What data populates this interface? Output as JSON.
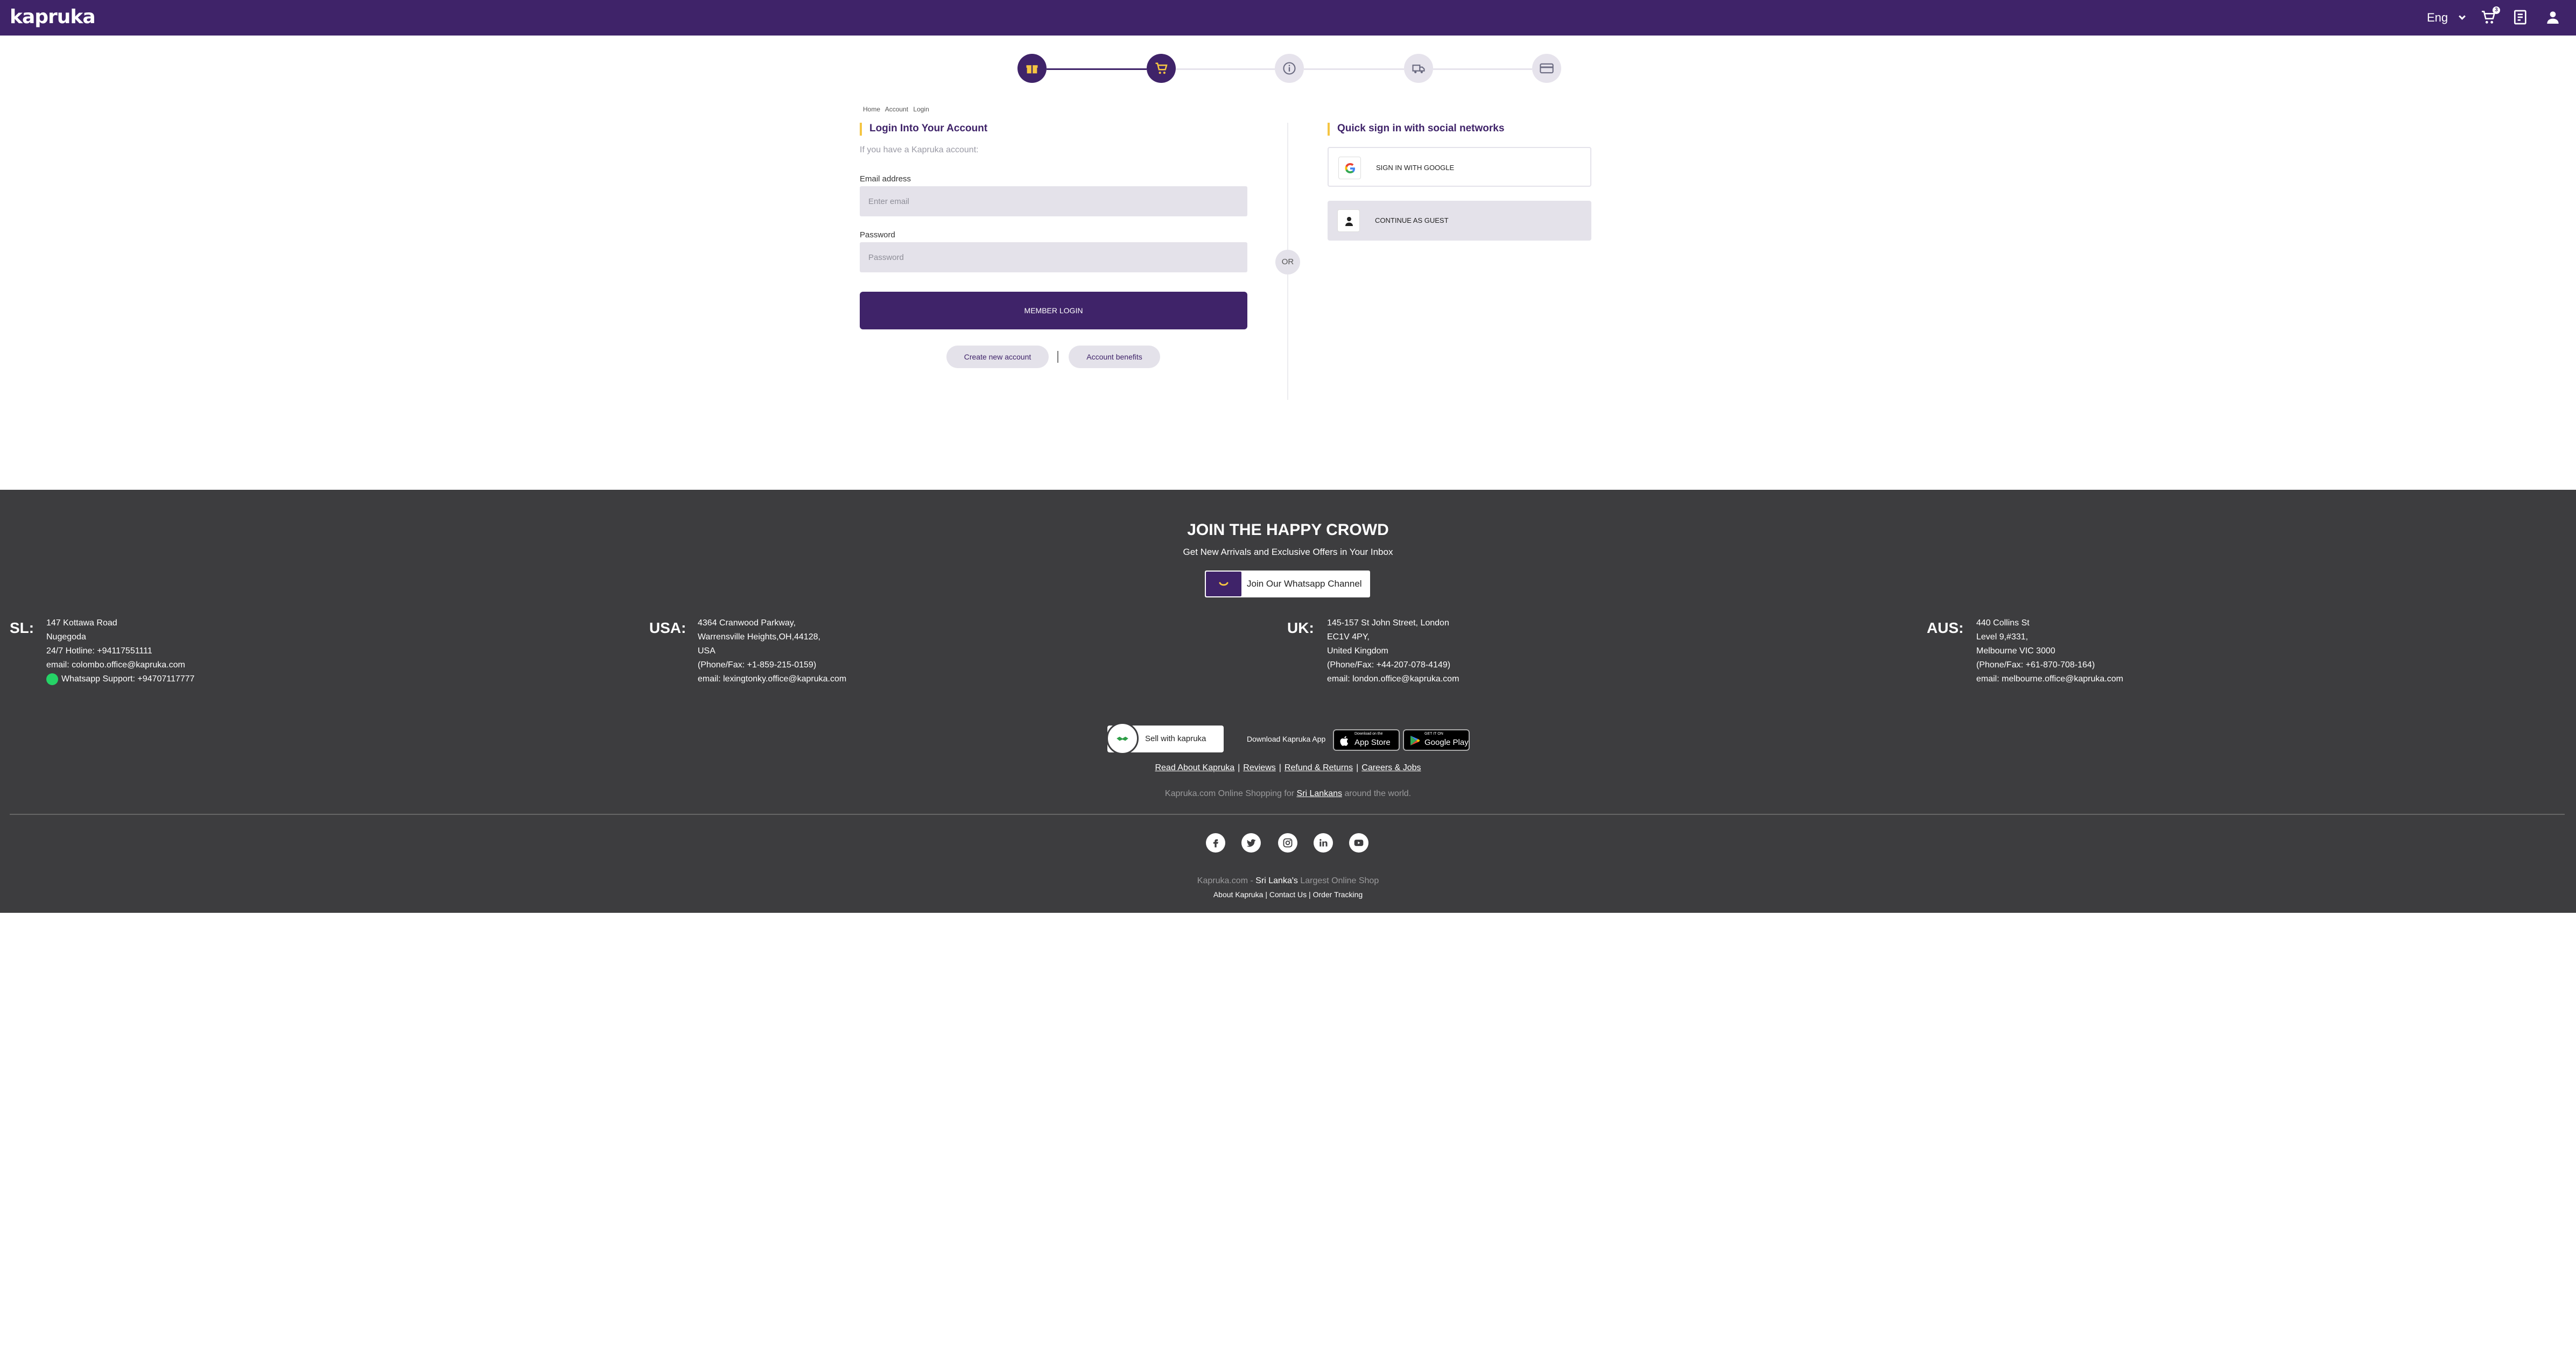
{
  "header": {
    "logo": "kapruka",
    "language": "Eng",
    "cart_count": "3",
    "icons": [
      "cart-icon",
      "orders-icon",
      "user-icon"
    ]
  },
  "checkout_steps": [
    {
      "icon": "gift-icon",
      "state": "done"
    },
    {
      "icon": "cart-icon",
      "state": "active"
    },
    {
      "icon": "info-icon",
      "state": "pending"
    },
    {
      "icon": "delivery-truck-icon",
      "state": "pending"
    },
    {
      "icon": "payment-card-icon",
      "state": "pending"
    }
  ],
  "breadcrumb": [
    "Home",
    "Account",
    "Login"
  ],
  "login": {
    "title": "Login Into Your Account",
    "subtitle": "If you have a Kapruka account:",
    "email_label": "Email address",
    "email_placeholder": "Enter email",
    "password_label": "Password",
    "password_placeholder": "Password",
    "submit_label": "MEMBER LOGIN",
    "create_account": "Create new account",
    "account_benefits": "Account benefits"
  },
  "or_label": "OR",
  "social": {
    "title": "Quick sign in with social networks",
    "google_label": "SIGN IN WITH GOOGLE",
    "guest_label": "CONTINUE AS GUEST"
  },
  "footer": {
    "join_title": "JOIN THE HAPPY CROWD",
    "join_sub": "Get New Arrivals and Exclusive Offers in Your Inbox",
    "whatsapp_channel": "Join Our Whatsapp Channel",
    "addresses": [
      {
        "country": "SL:",
        "lines": [
          "147 Kottawa Road",
          "Nugegoda",
          "24/7 Hotline: +94117551111",
          "email: colombo.office@kapruka.com",
          "Whatsapp Support: +94707117777"
        ]
      },
      {
        "country": "USA:",
        "lines": [
          "4364 Cranwood Parkway,",
          "Warrensville Heights,OH,44128,",
          "USA",
          "(Phone/Fax: +1-859-215-0159)",
          "email: lexingtonky.office@kapruka.com"
        ]
      },
      {
        "country": "UK:",
        "lines": [
          "145-157 St John Street, London",
          "EC1V 4PY,",
          "United Kingdom",
          "(Phone/Fax: +44-207-078-4149)",
          "email: london.office@kapruka.com"
        ]
      },
      {
        "country": "AUS:",
        "lines": [
          "440 Collins St",
          "Level 9,#331,",
          "Melbourne VIC 3000",
          "(Phone/Fax: +61-870-708-164)",
          "email: melbourne.office@kapruka.com"
        ]
      }
    ],
    "sell_label": "Sell with kapruka",
    "download_app": "Download Kapruka App",
    "app_store_small": "Download on the",
    "app_store_big": "App Store",
    "google_play_small": "GET IT ON",
    "google_play_big": "Google Play",
    "links": [
      "Read About Kapruka",
      "Reviews",
      "Refund & Returns",
      "Careers & Jobs"
    ],
    "tagline_pre": "Kapruka.com Online Shopping for",
    "tagline_link": "Sri Lankans",
    "tagline_post": "around the world.",
    "social_icons": [
      "facebook-icon",
      "twitter-icon",
      "instagram-icon",
      "linkedin-icon",
      "youtube-icon"
    ],
    "copy_pre": "Kapruka.com - ",
    "copy_hl": "Sri Lanka's",
    "copy_post": " Largest Online Shop",
    "bottom_links": [
      "About Kapruka",
      "Contact Us",
      "Order Tracking"
    ]
  },
  "colors": {
    "brand_purple": "#3f2369",
    "accent_yellow": "#f5c542",
    "footer_bg": "#3d3d3f"
  }
}
